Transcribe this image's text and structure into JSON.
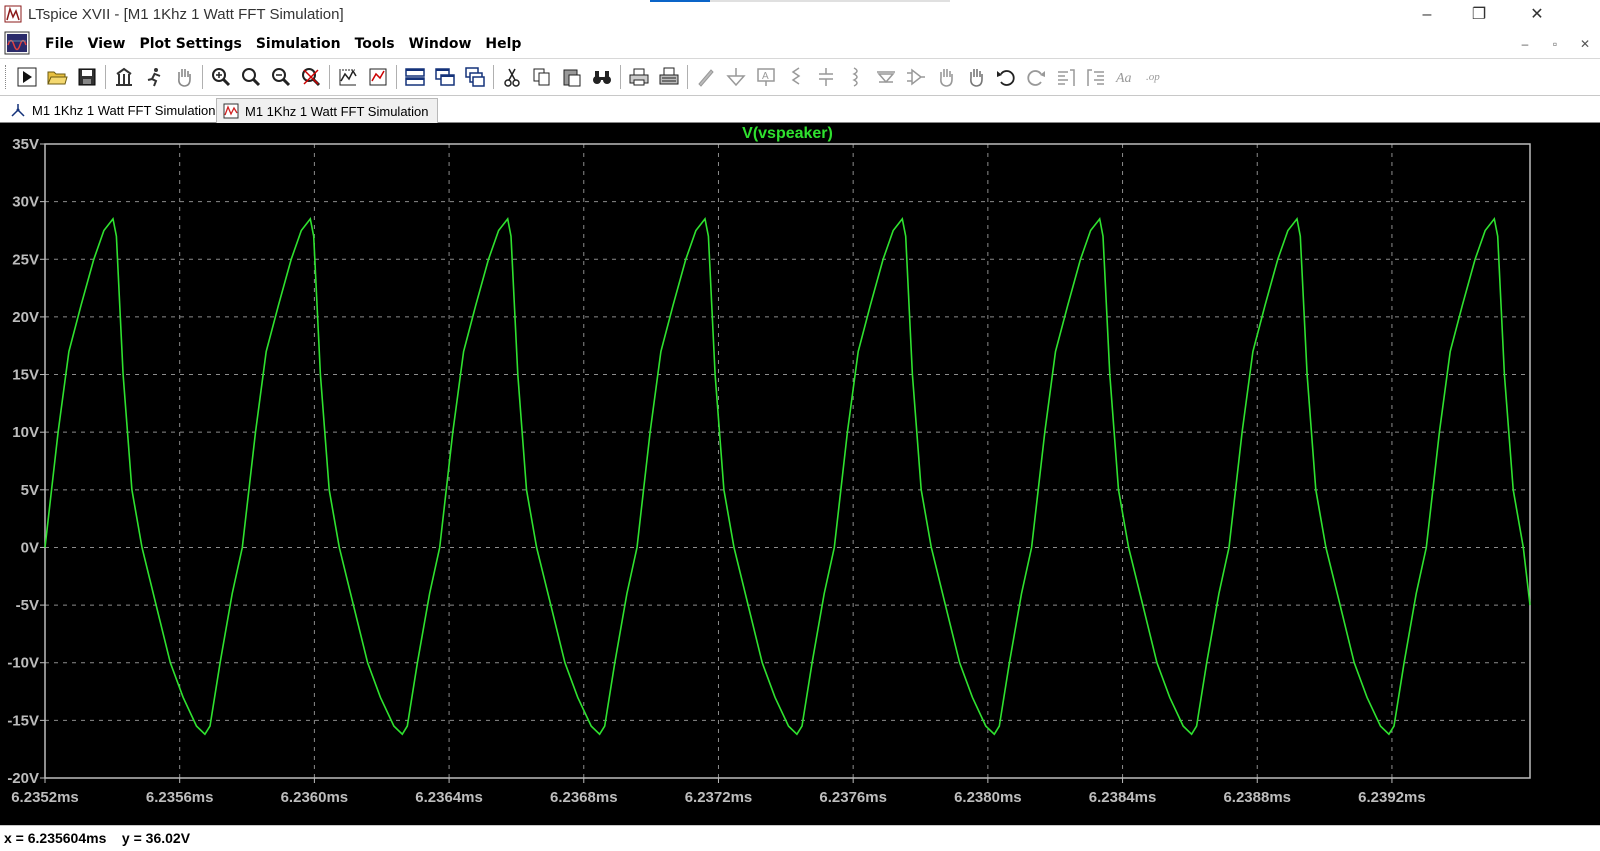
{
  "window": {
    "title": "LTspice XVII - [M1 1Khz 1 Watt FFT Simulation]",
    "minimize_glyph": "–",
    "restore_glyph": "❐",
    "close_glyph": "✕"
  },
  "menubar": {
    "items": [
      "File",
      "View",
      "Plot Settings",
      "Simulation",
      "Tools",
      "Window",
      "Help"
    ],
    "mdi_minimize": "–",
    "mdi_restore": "▫",
    "mdi_close": "✕"
  },
  "toolbar": {
    "icons": [
      "run-icon",
      "open-icon",
      "save-icon",
      "control-panel-icon",
      "halt-icon",
      "pan-hand-icon",
      "zoom-in-icon",
      "zoom-area-icon",
      "zoom-out-icon",
      "zoom-fit-icon",
      "autorange-icon",
      "setup-icon",
      "tile-horizontal-icon",
      "tile-vertical-icon",
      "cascade-icon",
      "cut-icon",
      "copy-icon",
      "paste-icon",
      "find-icon",
      "print-icon",
      "print-setup-icon",
      "draw-wire-icon",
      "ground-icon",
      "label-icon",
      "resistor-icon",
      "capacitor-icon",
      "inductor-icon",
      "diode-icon",
      "component-icon",
      "move-icon",
      "drag-icon",
      "undo-icon",
      "redo-icon",
      "rotate-icon",
      "mirror-icon",
      "text-icon",
      "spice-directive-icon"
    ]
  },
  "tabs": [
    {
      "label": "M1 1Khz 1 Watt FFT Simulation",
      "kind": "schematic"
    },
    {
      "label": "M1 1Khz 1 Watt FFT Simulation",
      "kind": "waveform",
      "active": true
    }
  ],
  "colors": {
    "trace": "#2fe12f",
    "plot_bg": "#000000",
    "grid": "#8c8c8c",
    "axis_text": "#bdbdbd"
  },
  "chart_data": {
    "type": "line",
    "title": "V(vspeaker)",
    "xlabel": "",
    "ylabel": "",
    "xlim": [
      6.2352,
      6.23961
    ],
    "ylim": [
      -20,
      35
    ],
    "x_ticks": [
      "6.2352ms",
      "6.2356ms",
      "6.2360ms",
      "6.2364ms",
      "6.2368ms",
      "6.2372ms",
      "6.2376ms",
      "6.2380ms",
      "6.2384ms",
      "6.2388ms",
      "6.2392ms"
    ],
    "x_tick_values": [
      6.2352,
      6.2356,
      6.236,
      6.2364,
      6.2368,
      6.2372,
      6.2376,
      6.238,
      6.2384,
      6.2388,
      6.2392
    ],
    "y_ticks": [
      "35V",
      "30V",
      "25V",
      "20V",
      "15V",
      "10V",
      "5V",
      "0V",
      "-5V",
      "-10V",
      "-15V",
      "-20V"
    ],
    "y_tick_values": [
      35,
      30,
      25,
      20,
      15,
      10,
      5,
      0,
      -5,
      -10,
      -15,
      -20
    ],
    "grid": true,
    "series": [
      {
        "name": "V(vspeaker)",
        "period_ms": 0.000586,
        "cycle_shape_ms": [
          {
            "dt": 0.0,
            "v": 0
          },
          {
            "dt": 3.9e-05,
            "v": 10
          },
          {
            "dt": 7.1e-05,
            "v": 17
          },
          {
            "dt": 0.000107,
            "v": 21
          },
          {
            "dt": 0.000145,
            "v": 25
          },
          {
            "dt": 0.000175,
            "v": 27.5
          },
          {
            "dt": 0.000202,
            "v": 28.5
          },
          {
            "dt": 0.000212,
            "v": 27
          },
          {
            "dt": 0.000232,
            "v": 15
          },
          {
            "dt": 0.000258,
            "v": 5
          },
          {
            "dt": 0.000288,
            "v": 0
          },
          {
            "dt": 0.00033,
            "v": -5
          },
          {
            "dt": 0.000372,
            "v": -10
          },
          {
            "dt": 0.00041,
            "v": -13
          },
          {
            "dt": 0.00045,
            "v": -15.5
          },
          {
            "dt": 0.000475,
            "v": -16.2
          },
          {
            "dt": 0.00049,
            "v": -15.5
          },
          {
            "dt": 0.00052,
            "v": -10
          },
          {
            "dt": 0.000556,
            "v": -4
          },
          {
            "dt": 0.000586,
            "v": 0
          }
        ],
        "x_start": 6.2352,
        "x_end": 6.23961
      }
    ]
  },
  "status": {
    "cursor_readout": "x = 6.235604ms    y = 36.02V"
  }
}
